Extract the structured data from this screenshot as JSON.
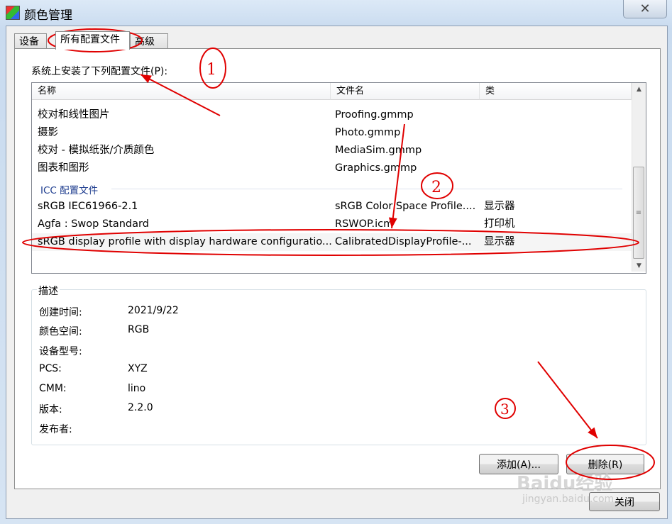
{
  "window": {
    "title": "颜色管理",
    "close_glyph": "✕"
  },
  "tabs": [
    {
      "label": "设备"
    },
    {
      "label": "所有配置文件"
    },
    {
      "label": "高级"
    }
  ],
  "installed_label": "系统上安装了下列配置文件(P):",
  "columns": {
    "name": "名称",
    "file": "文件名",
    "class": "类"
  },
  "rows_a": [
    {
      "name": "校对和线性图片",
      "file": "Proofing.gmmp",
      "class": ""
    },
    {
      "name": "摄影",
      "file": "Photo.gmmp",
      "class": ""
    },
    {
      "name": "校对 - 模拟纸张/介质颜色",
      "file": "MediaSim.gmmp",
      "class": ""
    },
    {
      "name": "图表和图形",
      "file": "Graphics.gmmp",
      "class": ""
    }
  ],
  "group_label": "ICC 配置文件",
  "rows_b": [
    {
      "name": "sRGB IEC61966-2.1",
      "file": "sRGB Color Space Profile....",
      "class": "显示器"
    },
    {
      "name": "Agfa : Swop Standard",
      "file": "RSWOP.icm",
      "class": "打印机"
    },
    {
      "name": "sRGB display profile with display hardware configuratio...",
      "file": "CalibratedDisplayProfile-...",
      "class": "显示器"
    }
  ],
  "description": {
    "title": "描述",
    "fields": [
      {
        "key": "创建时间:",
        "value": "2021/9/22"
      },
      {
        "key": "颜色空间:",
        "value": "RGB"
      },
      {
        "key": "设备型号:",
        "value": ""
      },
      {
        "key": "PCS:",
        "value": "XYZ"
      },
      {
        "key": "CMM:",
        "value": "lino"
      },
      {
        "key": "版本:",
        "value": "2.2.0"
      },
      {
        "key": "发布者:",
        "value": ""
      }
    ]
  },
  "buttons": {
    "add": "添加(A)...",
    "delete": "删除(R)",
    "close": "关闭"
  },
  "annotations": {
    "one": "1",
    "two": "2",
    "three": "3",
    "color": "#e00000"
  },
  "watermark": {
    "text": "Baidu经验",
    "sub": "jingyan.baidu.com"
  }
}
